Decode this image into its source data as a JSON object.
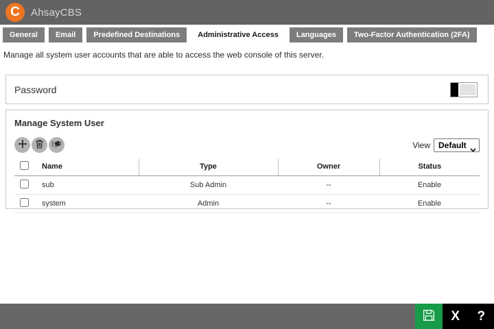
{
  "header": {
    "logo_letter": "C",
    "title": "AhsayCBS"
  },
  "tabs": {
    "items": [
      {
        "label": "General",
        "active": false
      },
      {
        "label": "Email",
        "active": false
      },
      {
        "label": "Predefined Destinations",
        "active": false
      },
      {
        "label": "Administrative Access",
        "active": true
      },
      {
        "label": "Languages",
        "active": false
      },
      {
        "label": "Two-Factor Authentication (2FA)",
        "active": false
      }
    ]
  },
  "page": {
    "description": "Manage all system user accounts that are able to access the web console of this server."
  },
  "password": {
    "label": "Password",
    "toggle_state": "off"
  },
  "manage": {
    "title": "Manage System User",
    "toolbar": {
      "add_icon": "plus-icon",
      "delete_icon": "trash-icon",
      "announce_icon": "megaphone-icon"
    },
    "view": {
      "label": "View",
      "selected": "Default"
    },
    "table": {
      "headers": {
        "name": "Name",
        "type": "Type",
        "owner": "Owner",
        "status": "Status"
      },
      "rows": [
        {
          "name": "sub",
          "type": "Sub Admin",
          "owner": "--",
          "status": "Enable"
        },
        {
          "name": "system",
          "type": "Admin",
          "owner": "--",
          "status": "Enable"
        }
      ]
    }
  },
  "footer": {
    "save_icon": "floppy-disk-icon",
    "close_label": "X",
    "help_label": "?"
  },
  "colors": {
    "brand_orange": "#ED7622",
    "header_bg": "#636363",
    "tab_bg": "#7D7D7D",
    "active_tab_bg": "#FFFFFF",
    "footer_bg": "#666666",
    "save_green": "#189B48",
    "footer_black": "#000000"
  }
}
